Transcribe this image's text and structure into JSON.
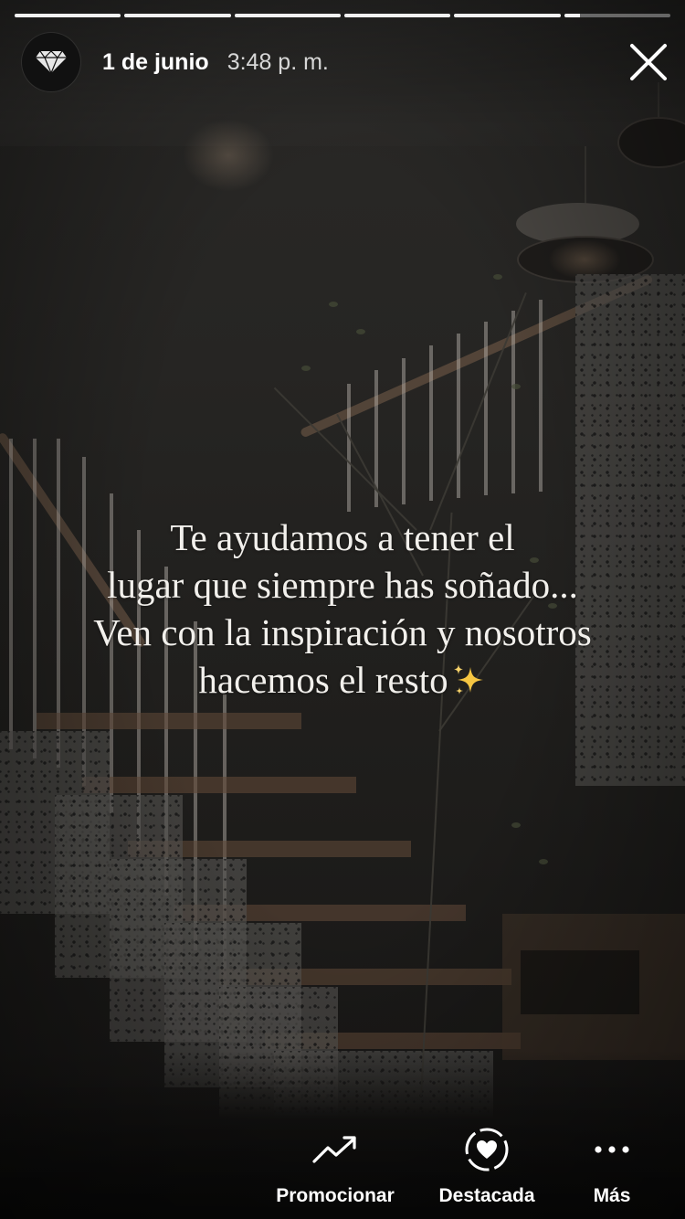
{
  "story": {
    "segments": [
      1,
      1,
      1,
      1,
      1,
      0.15
    ],
    "header": {
      "date": "1 de junio",
      "time": "3:48 p. m.",
      "avatar_icon": "diamond-icon",
      "close_icon": "close-icon"
    },
    "caption": {
      "lines": [
        "Te ayudamos a tener el",
        "lugar que siempre has soñado...",
        "Ven con la inspiración y nosotros",
        "hacemos el resto"
      ],
      "emoji": "sparkles-icon"
    },
    "actions": [
      {
        "label": "Promocionar",
        "icon": "trending-up-icon"
      },
      {
        "label": "Destacada",
        "icon": "highlight-heart-icon"
      },
      {
        "label": "Más",
        "icon": "more-dots-icon"
      }
    ]
  },
  "colors": {
    "text": "#ffffff",
    "caption": "#f2f0ec",
    "sparkle": "#f5c542",
    "progress_track": "rgba(255,255,255,0.35)",
    "progress_fill": "rgba(255,255,255,0.92)"
  }
}
